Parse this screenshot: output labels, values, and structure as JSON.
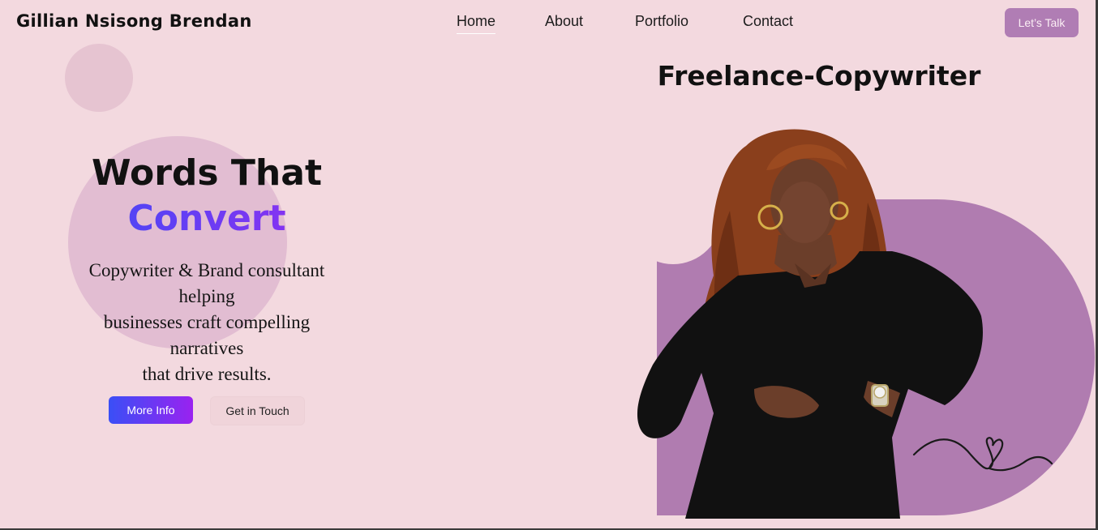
{
  "header": {
    "brand": "Gillian Nsisong Brendan",
    "nav": [
      {
        "label": "Home",
        "active": true
      },
      {
        "label": "About",
        "active": false
      },
      {
        "label": "Portfolio",
        "active": false
      },
      {
        "label": "Contact",
        "active": false
      }
    ],
    "cta_label": "Let’s Talk"
  },
  "hero": {
    "title_line1": "Words That",
    "title_line2": "Convert",
    "subtitle_lines": [
      "Copywriter & Brand consultant",
      "helping",
      "businesses craft compelling",
      "narratives",
      "that drive results."
    ],
    "primary_button": "More Info",
    "secondary_button": "Get in Touch"
  },
  "profile": {
    "role_title": "Freelance-Copywriter"
  },
  "colors": {
    "background": "#f3d9df",
    "accent": "#b07cb0",
    "gradient_start": "#3b4cf6",
    "gradient_end": "#9b2cf0"
  }
}
